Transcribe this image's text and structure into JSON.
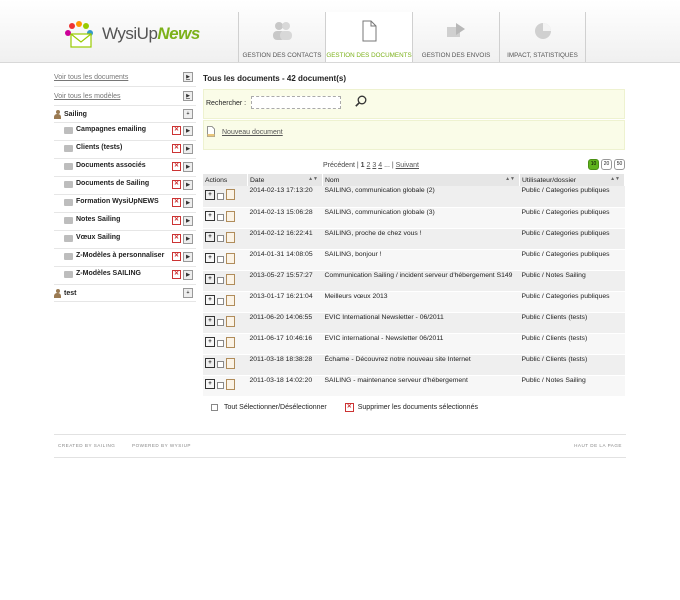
{
  "app": {
    "logo_prefix": "WysiUp",
    "logo_suffix": "News"
  },
  "nav": {
    "tabs": [
      {
        "label": "GESTION DES CONTACTS",
        "icon": "contacts-icon",
        "active": false
      },
      {
        "label": "GESTION DES DOCUMENTS",
        "icon": "document-icon",
        "active": true
      },
      {
        "label": "GESTION DES ENVOIS",
        "icon": "send-icon",
        "active": false
      },
      {
        "label": "IMPACT, STATISTIQUES",
        "icon": "pie-chart-icon",
        "active": false
      }
    ]
  },
  "sidebar": {
    "links": [
      "Voir tous les documents",
      "Voir tous les modèles"
    ],
    "user1": "Sailing",
    "folders": [
      "Campagnes emailing",
      "Clients (tests)",
      "Documents associés",
      "Documents de Sailing",
      "Formation WysiUpNEWS",
      "Notes Sailing",
      "Vœux Sailing",
      "Z-Modèles à personnaliser",
      "Z-Modèles SAILING"
    ],
    "user2": "test"
  },
  "main": {
    "title": "Tous les documents - 42 document(s)",
    "search_label": "Rechercher :",
    "search_value": "",
    "new_document": "Nouveau document",
    "pager": {
      "prev": "Précédent",
      "current": "1",
      "pages": [
        "2",
        "3",
        "4"
      ],
      "ellipsis": "...",
      "next": "Suivant"
    },
    "per_page": [
      "10",
      "20",
      "50"
    ],
    "per_page_selected": "10",
    "columns": [
      "Actions",
      "Date",
      "Nom",
      "Utilisateur/dossier"
    ],
    "rows": [
      {
        "date": "2014-02-13 17:13:20",
        "name": "SAILING, communication globale (2)",
        "owner": "Public / Categories publiques"
      },
      {
        "date": "2014-02-13 15:06:28",
        "name": "SAILING, communication globale (3)",
        "owner": "Public / Categories publiques"
      },
      {
        "date": "2014-02-12 16:22:41",
        "name": "SAILING, proche de chez vous !",
        "owner": "Public / Categories publiques"
      },
      {
        "date": "2014-01-31 14:08:05",
        "name": "SAILING, bonjour !",
        "owner": "Public / Categories publiques"
      },
      {
        "date": "2013-05-27 15:57:27",
        "name": "Communication Sailing / incident serveur d'hébergement S149",
        "owner": "Public / Notes Sailing"
      },
      {
        "date": "2013-01-17 16:21:04",
        "name": "Meilleurs vœux 2013",
        "owner": "Public / Categories publiques"
      },
      {
        "date": "2011-06-20 14:06:55",
        "name": "EVIC International Newsletter - 06/2011",
        "owner": "Public / Clients (tests)"
      },
      {
        "date": "2011-06-17 10:46:16",
        "name": "EVIC international - Newsletter 06/2011",
        "owner": "Public / Clients (tests)"
      },
      {
        "date": "2011-03-18 18:38:28",
        "name": "Échame - Découvrez notre nouveau site Internet",
        "owner": "Public / Clients (tests)"
      },
      {
        "date": "2011-03-18 14:02:20",
        "name": "SAILING - maintenance serveur d'hébergement",
        "owner": "Public / Notes Sailing"
      }
    ],
    "select_all": "Tout Sélectionner/Désélectionner",
    "delete_selected": "Supprimer les documents sélectionnés"
  },
  "footer": {
    "created": "CREATED BY SAILING",
    "powered": "POWERED BY WYSIUP",
    "top": "HAUT DE LA PAGE"
  },
  "colors": {
    "accent": "#7cb11a",
    "panel_bg": "#fafce8",
    "delete": "#cc3333"
  }
}
